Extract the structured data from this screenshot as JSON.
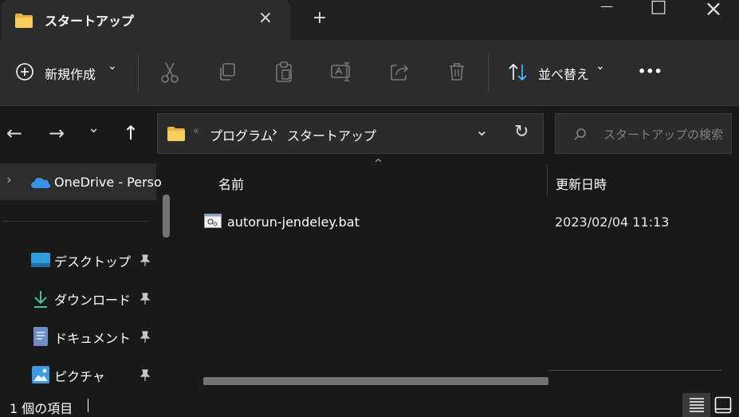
{
  "tab": {
    "title": "スタートアップ",
    "close_icon": "×",
    "new_icon": "+"
  },
  "window": {
    "minimize": "—",
    "maximize": "□",
    "close": "×"
  },
  "toolbar": {
    "new_label": "新規作成",
    "new_caret": "⌄",
    "sort_label": "並べ替え",
    "sort_caret": "⌄",
    "more": "•••"
  },
  "nav": {
    "back": "←",
    "forward": "→",
    "history": "⌄",
    "up": "↑"
  },
  "address": {
    "sep": "«",
    "crumb1": "プログラム",
    "chevron": "›",
    "crumb2": "スタートアップ",
    "dropdown": "⌄",
    "refresh": "↻"
  },
  "search": {
    "placeholder": "スタートアップの検索",
    "icon": "⌕"
  },
  "sidebar": {
    "onedrive": "OneDrive - Perso",
    "onedrive_expand": "›",
    "items": [
      {
        "label": "デスクトップ",
        "pin": "📌"
      },
      {
        "label": "ダウンロード",
        "pin": "📌"
      },
      {
        "label": "ドキュメント",
        "pin": "📌"
      },
      {
        "label": "ピクチャ",
        "pin": "📌"
      }
    ]
  },
  "columns": {
    "name": "名前",
    "date": "更新日時",
    "sort_indicator": "^"
  },
  "files": [
    {
      "name": "autorun-jendeley.bat",
      "date": "2023/02/04 11:13"
    }
  ],
  "status": {
    "text": "1 個の項目"
  },
  "colors": {
    "folder": "#f0c24d",
    "accent": "#4cc2ff",
    "onedrive": "#3b8fe8"
  }
}
